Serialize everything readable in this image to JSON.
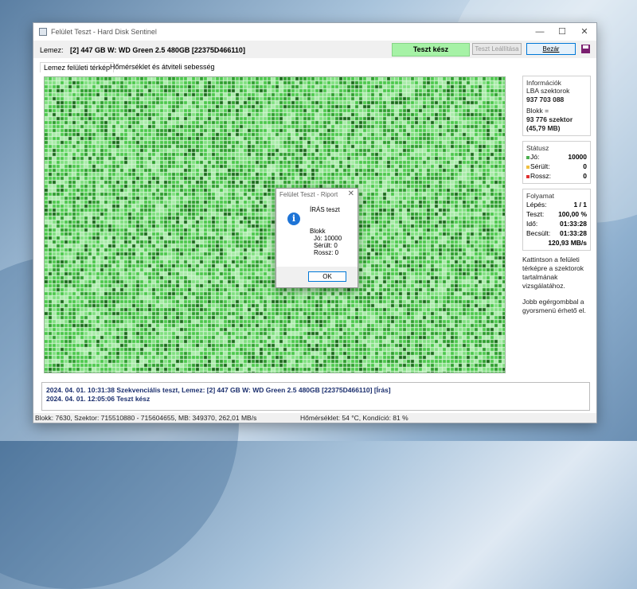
{
  "window": {
    "title": "Felület Teszt - Hard Disk Sentinel",
    "controls": {
      "minimize": "—",
      "maximize": "☐",
      "close": "✕"
    }
  },
  "toolbar": {
    "disk_label": "Lemez:",
    "disk_name": "[2] 447 GB W: WD Green 2.5 480GB [22375D466110]",
    "status": "Teszt kész",
    "stop_button": "Teszt Leállítása",
    "close_button": "Bezár",
    "save_icon": "save-icon"
  },
  "tabs": [
    "Lemez felületi térkép",
    "Hőmérséklet és átviteli sebesség"
  ],
  "sidebar": {
    "info": {
      "title": "Információk",
      "lba_label": "LBA szektorok",
      "lba_value": "937 703 088",
      "block_label": "Blokk =",
      "block_value": "93 776 szektor",
      "block_size": "(45,79 MB)"
    },
    "status": {
      "title": "Státusz",
      "good_label": "Jó:",
      "good_value": "10000",
      "damaged_label": "Sérült:",
      "damaged_value": "0",
      "bad_label": "Rossz:",
      "bad_value": "0",
      "good_color": "#4caf50",
      "damaged_color": "#f0c040",
      "bad_color": "#e03030"
    },
    "progress": {
      "title": "Folyamat",
      "step_label": "Lépés:",
      "step_value": "1 / 1",
      "test_label": "Teszt:",
      "test_value": "100,00 %",
      "time_label": "Idő:",
      "time_value": "01:33:28",
      "est_label": "Becsült:",
      "est_value": "01:33:28",
      "speed": "120,93 MB/s"
    },
    "hint1": "Kattintson a felületi térképre a szektorok tartalmának vizsgálatához.",
    "hint2": "Jobb egérgombbal a gyorsmenü érhető el."
  },
  "log": [
    "2024. 04. 01.  10:31:38   Szekvenciális teszt, Lemez: [2] 447 GB W: WD Green 2.5 480GB [22375D466110] [Írás]",
    "2024. 04. 01.  12:05:06   Teszt kész"
  ],
  "statusbar": {
    "left": "Blokk: 7630, Szektor: 715510880 - 715604655, MB: 349370, 262,01 MB/s",
    "right": "Hőmérséklet: 54  °C,  Kondíció: 81 %"
  },
  "dialog": {
    "title": "Felület Teszt - Riport",
    "heading": "ÍRÁS teszt",
    "block_label": "Blokk",
    "good": "Jó: 10000",
    "damaged": "Sérült: 0",
    "bad": "Rossz: 0",
    "ok_button": "OK"
  },
  "surface_map": {
    "colors": [
      "#7fe07f",
      "#4cc84c",
      "#2e9e2e",
      "#1a6b1a",
      "#a8eca8",
      "#c8f5c8"
    ]
  }
}
